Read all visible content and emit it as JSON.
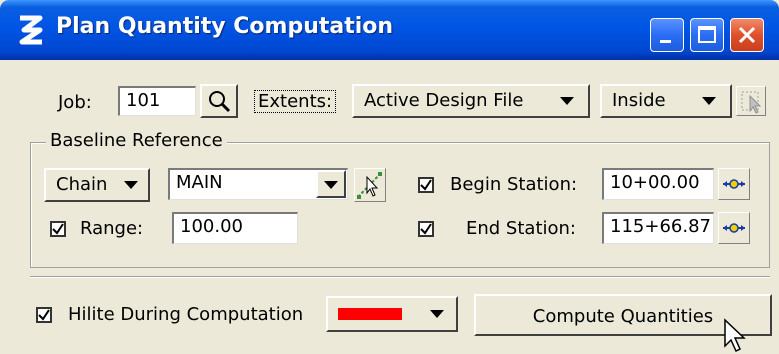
{
  "window": {
    "title": "Plan Quantity Computation"
  },
  "job": {
    "label": "Job:",
    "value": "101"
  },
  "extents": {
    "label": "Extents:",
    "selected": "Active Design File",
    "mode": "Inside"
  },
  "baseline": {
    "group_label": "Baseline Reference",
    "chain_button": "Chain",
    "chain_value": "MAIN",
    "begin_station_label": "Begin Station:",
    "begin_station_value": "10+00.00",
    "begin_station_checked": true,
    "end_station_label": "End Station:",
    "end_station_value": "115+66.87",
    "end_station_checked": true,
    "range_label": "Range:",
    "range_value": "100.00",
    "range_checked": true
  },
  "hilite": {
    "label": "Hilite During Computation",
    "checked": true,
    "color": "#ff0000"
  },
  "compute_button": "Compute Quantities",
  "icons": [
    "app-logo-icon",
    "minimize-icon",
    "maximize-icon",
    "close-icon",
    "magnifier-icon",
    "select-element-icon",
    "chain-select-icon",
    "station-target-icon",
    "cursor-arrow-icon"
  ]
}
